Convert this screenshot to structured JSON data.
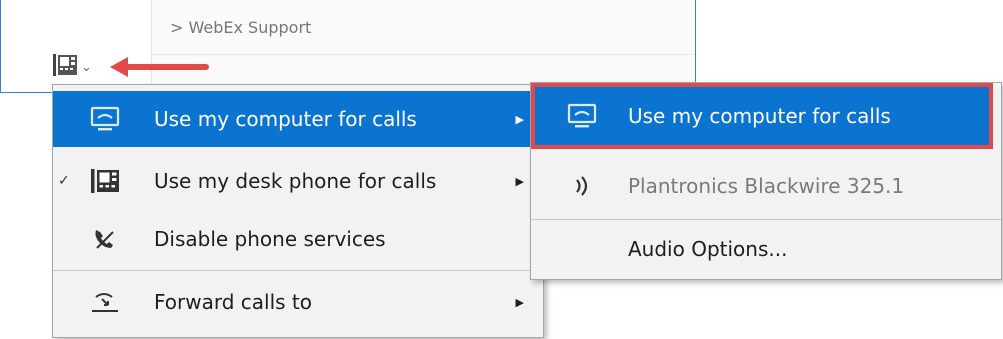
{
  "background": {
    "list_row_label": "> WebEx Support",
    "phone_button_icon": "desk-phone-icon",
    "phone_button_chevron": "⌄"
  },
  "menu": {
    "items": [
      {
        "label": "Use my computer for calls",
        "icon": "computer-phone-icon",
        "checked": false,
        "submenu": true,
        "selected": true
      },
      {
        "label": "Use my desk phone for calls",
        "icon": "desk-phone-icon",
        "checked": true,
        "submenu": true,
        "selected": false
      },
      {
        "label": "Disable phone services",
        "icon": "disabled-phone-icon",
        "checked": false,
        "submenu": false,
        "selected": false
      },
      {
        "label": "Forward calls to",
        "icon": "forward-calls-icon",
        "checked": false,
        "submenu": true,
        "selected": false
      }
    ],
    "check_glyph": "✓",
    "submenu_glyph": "▶"
  },
  "submenu": {
    "items": [
      {
        "label": "Use my computer for calls",
        "icon": "computer-phone-icon",
        "selected": true
      },
      {
        "label": "Plantronics Blackwire 325.1",
        "icon": "audio-device-icon",
        "disabled": true
      },
      {
        "label": "Audio Options...",
        "icon": "",
        "disabled": false
      }
    ]
  },
  "colors": {
    "selection_blue": "#0b74d1",
    "highlight_red": "#e14a4a",
    "menu_bg": "#f2f2f2"
  }
}
